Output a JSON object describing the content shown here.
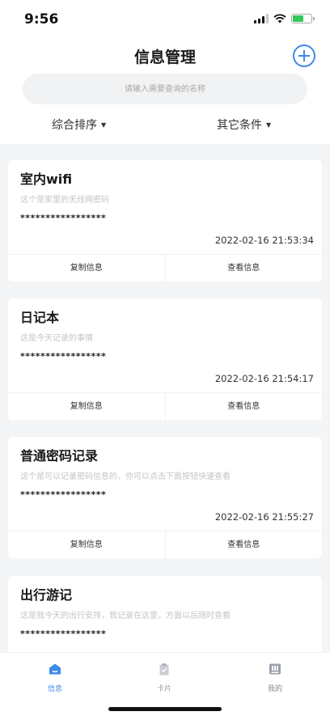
{
  "status_bar": {
    "time": "9:56"
  },
  "header": {
    "title": "信息管理"
  },
  "search": {
    "placeholder": "请输入需要查询的名称"
  },
  "filters": {
    "sort_label": "综合排序",
    "conditions_label": "其它条件"
  },
  "cards": [
    {
      "title": "室内wifi",
      "description": "这个是家里的无线网密码",
      "masked": "*****************",
      "timestamp": "2022-02-16 21:53:34",
      "copy_label": "复制信息",
      "view_label": "查看信息"
    },
    {
      "title": "日记本",
      "description": "这是今天记录的事情",
      "masked": "*****************",
      "timestamp": "2022-02-16 21:54:17",
      "copy_label": "复制信息",
      "view_label": "查看信息"
    },
    {
      "title": "普通密码记录",
      "description": "这个是可以记录密码信息的，你可以点击下面按钮快速查看",
      "masked": "*****************",
      "timestamp": "2022-02-16 21:55:27",
      "copy_label": "复制信息",
      "view_label": "查看信息"
    },
    {
      "title": "出行游记",
      "description": "这是我今天的出行安排，我记录在这里，方面以后随时查看",
      "masked": "*****************"
    }
  ],
  "tabbar": {
    "items": [
      {
        "label": "信息",
        "icon": "home-icon",
        "active": true
      },
      {
        "label": "卡片",
        "icon": "clipboard-icon",
        "active": false
      },
      {
        "label": "我的",
        "icon": "profile-icon",
        "active": false
      }
    ]
  },
  "colors": {
    "accent": "#3a8be8",
    "background": "#f4f5f7",
    "card": "#ffffff"
  }
}
